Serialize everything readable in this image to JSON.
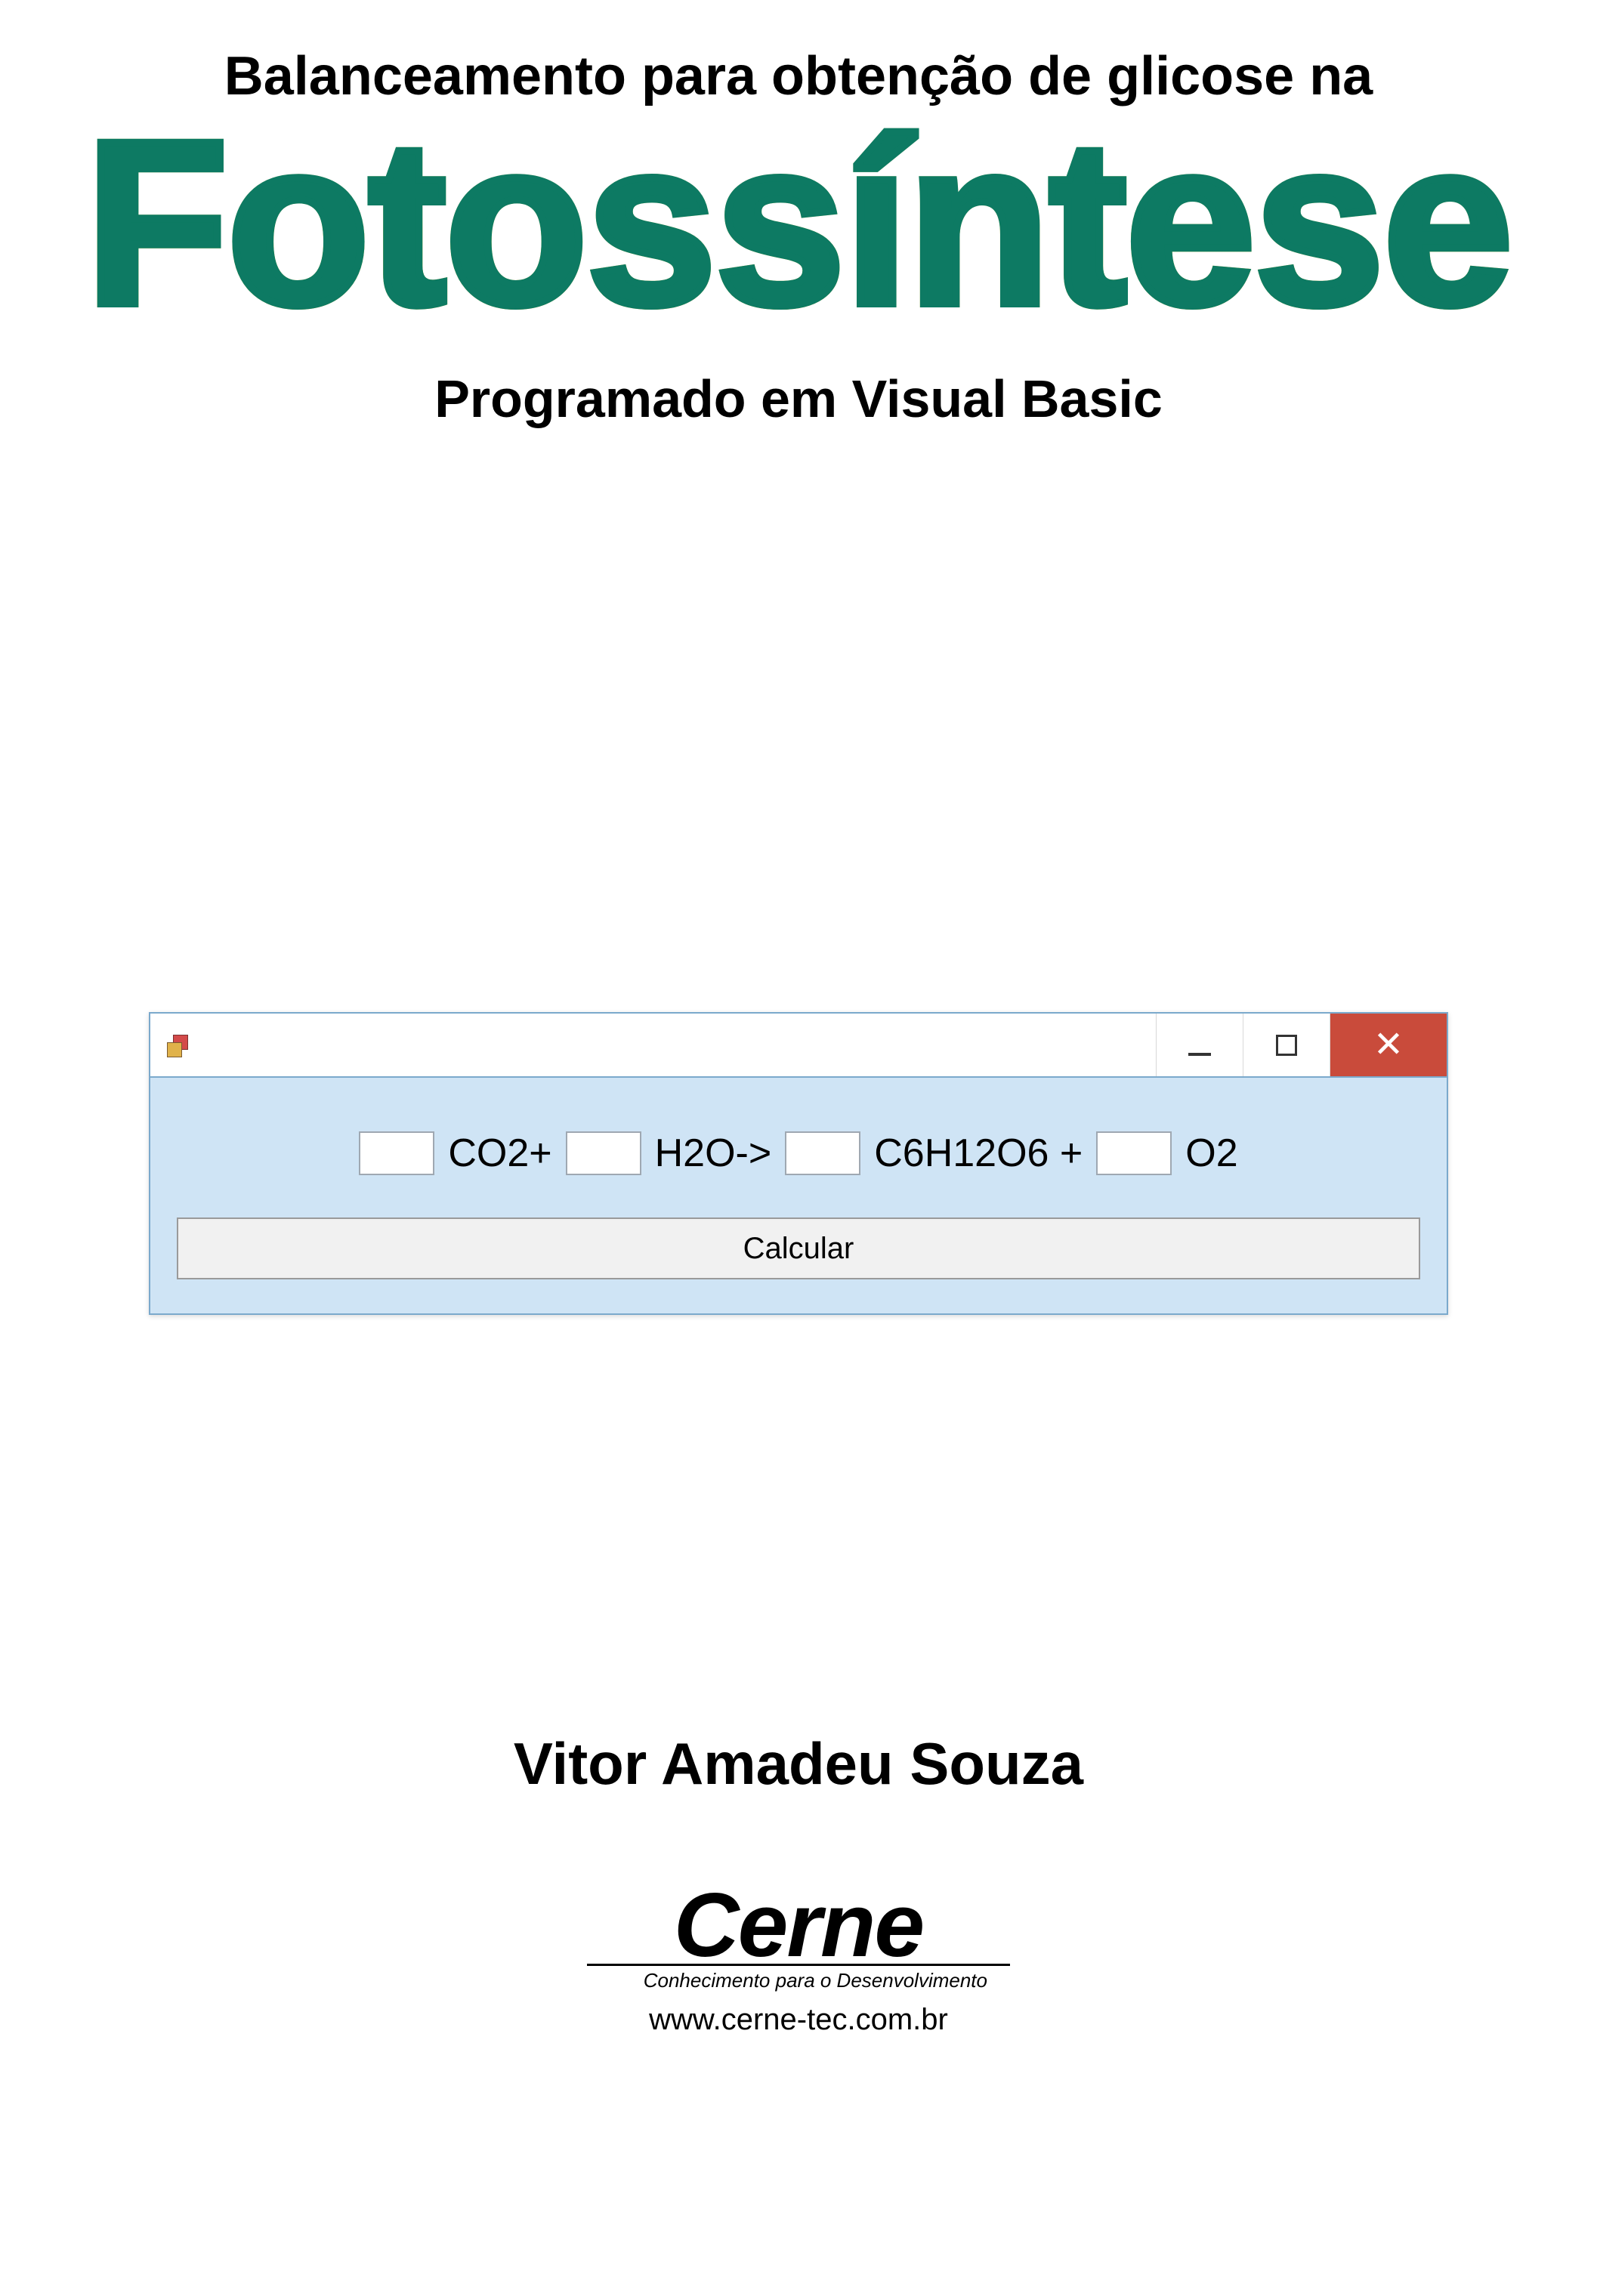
{
  "header": {
    "line1": "Balanceamento para obtenção de glicose na",
    "big_title": "Fotossíntese",
    "line3": "Programado em Visual Basic"
  },
  "window": {
    "equation": {
      "co2_label": "CO2+",
      "h2o_label": "H2O->",
      "glucose_label": "C6H12O6 +",
      "o2_label": "O2"
    },
    "calc_button": "Calcular"
  },
  "author": "Vitor Amadeu Souza",
  "logo": {
    "name": "Cerne",
    "tagline": "Conhecimento para o Desenvolvimento",
    "url": "www.cerne-tec.com.br"
  }
}
